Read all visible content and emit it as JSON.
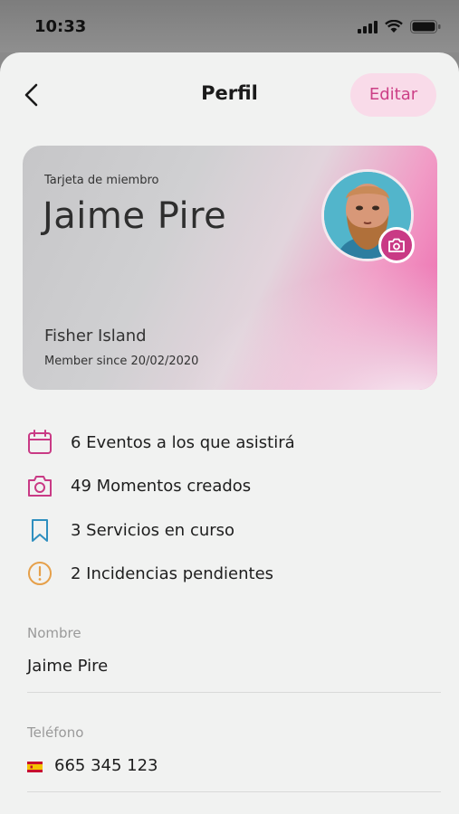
{
  "status": {
    "time": "10:33"
  },
  "nav": {
    "title": "Perfil",
    "edit_label": "Editar"
  },
  "card": {
    "label": "Tarjeta de miembro",
    "name": "Jaime Pire",
    "place": "Fisher Island",
    "since": "Member since 20/02/2020"
  },
  "stats": [
    {
      "icon": "calendar-icon",
      "text": "6 Eventos a los que asistirá",
      "color": "#c93a85"
    },
    {
      "icon": "camera-icon",
      "text": "49 Momentos creados",
      "color": "#c93a85"
    },
    {
      "icon": "bookmark-icon",
      "text": "3 Servicios en curso",
      "color": "#2f8fbf"
    },
    {
      "icon": "alert-circle-icon",
      "text": "2 Incidencias pendientes",
      "color": "#e6a04a"
    }
  ],
  "fields": {
    "name": {
      "label": "Nombre",
      "value": "Jaime Pire"
    },
    "phone": {
      "label": "Teléfono",
      "value": "665 345 123",
      "flag_icon": "spain-flag-icon"
    }
  },
  "colors": {
    "accent": "#c93a85",
    "edit_bg": "#f9dbe9",
    "background": "#f1f2f1"
  }
}
